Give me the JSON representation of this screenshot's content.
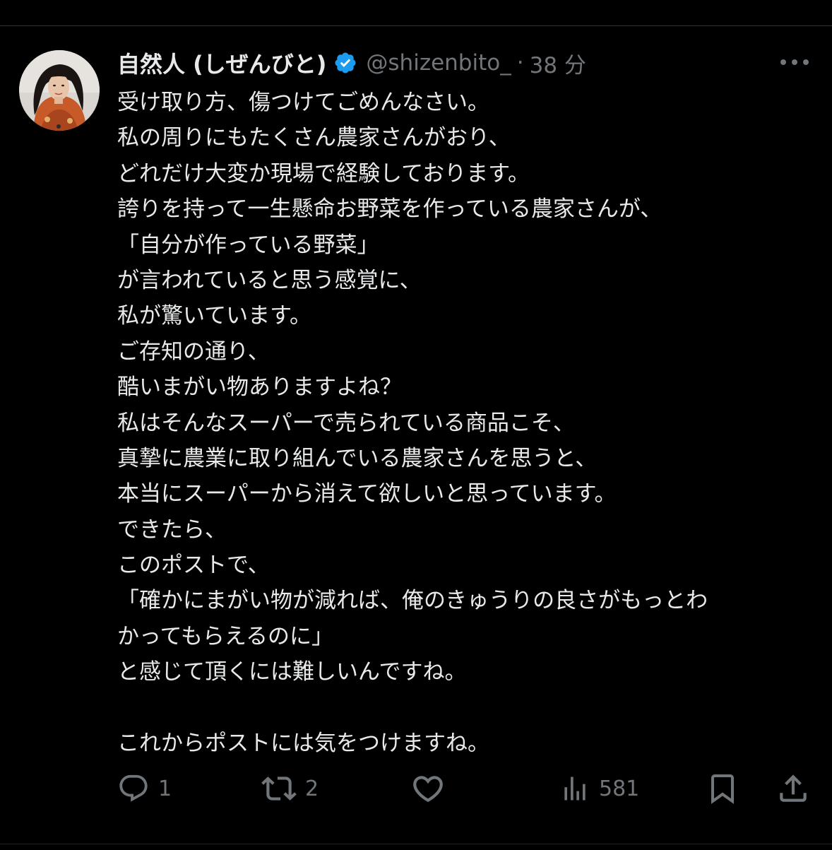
{
  "tweet": {
    "author": {
      "display_name": "自然人 (しぜんびと)",
      "handle": "@shizenbito_",
      "verified": true
    },
    "separator": "·",
    "time": "38 分",
    "lines": [
      "受け取り方、傷つけてごめんなさい。",
      "私の周りにもたくさん農家さんがおり、",
      "どれだけ大変か現場で経験しております。",
      "誇りを持って一生懸命お野菜を作っている農家さんが、",
      "「自分が作っている野菜」",
      "が言われていると思う感覚に、",
      "私が驚いています。",
      "ご存知の通り、",
      "酷いまがい物ありますよね？",
      "私はそんなスーパーで売られている商品こそ、",
      "真摯に農業に取り組んでいる農家さんを思うと、",
      "本当にスーパーから消えて欲しいと思っています。",
      "できたら、",
      "このポストで、",
      "「確かにまがい物が減れば、俺のきゅうりの良さがもっとわ",
      "かってもらえるのに」",
      "と感じて頂くには難しいんですね。",
      "",
      "これからポストには気をつけますね。"
    ]
  },
  "actions": {
    "replies": "1",
    "reposts": "2",
    "views": "581"
  },
  "colors": {
    "background": "#000000",
    "text": "#e7e9ea",
    "secondary": "#71767b",
    "verified": "#1d9bf0"
  },
  "icons": {
    "avatar": "profile-photo",
    "verified": "verified-badge-icon",
    "more": "more-dots-icon",
    "reply": "reply-icon",
    "repost": "repost-icon",
    "like": "like-heart-icon",
    "views": "views-chart-icon",
    "bookmark": "bookmark-icon",
    "share": "share-icon"
  }
}
